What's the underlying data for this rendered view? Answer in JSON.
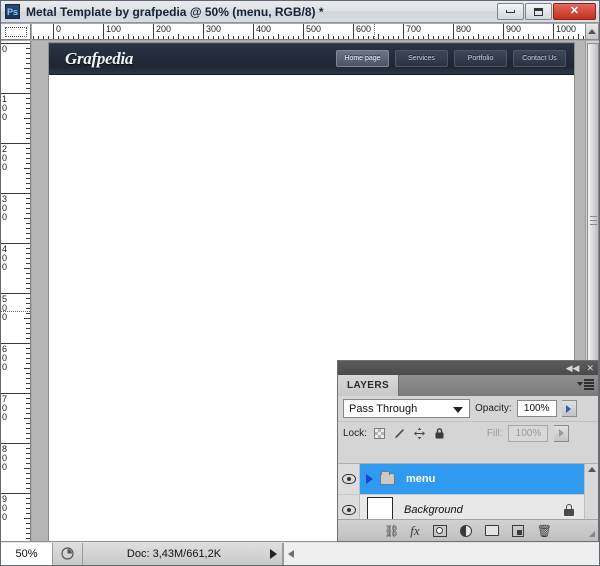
{
  "window": {
    "app_icon": "photoshop-logo-icon",
    "app_icon_text": "Ps",
    "title": "Metal Template by grafpedia @ 50% (menu, RGB/8) *",
    "controls": {
      "minimize": "minimize-icon",
      "maximize": "maximize-icon",
      "close": "✕"
    }
  },
  "rulers": {
    "unit_spacing_px": 50,
    "horizontal_labels": [
      "0",
      "100",
      "200",
      "300",
      "400",
      "500",
      "600",
      "700",
      "800",
      "900",
      "1000"
    ],
    "vertical_labels": [
      "0",
      "100",
      "200",
      "300",
      "400",
      "500",
      "600",
      "700",
      "800",
      "900"
    ],
    "horizontal_guide_at": "600",
    "vertical_guide_at": "500"
  },
  "canvas": {
    "site_header": {
      "logo": "Grafpedia",
      "nav": [
        {
          "label": "Home page",
          "active": true
        },
        {
          "label": "Services",
          "active": false
        },
        {
          "label": "Portfolio",
          "active": false
        },
        {
          "label": "Contact Us",
          "active": false
        }
      ]
    }
  },
  "statusbar": {
    "zoom": "50%",
    "status_icon": "document-thumb-icon",
    "doc_info": "Doc: 3,43M/661,2K",
    "expand_icon": "play-arrow-icon",
    "scroll_left_icon": "scroll-left-icon"
  },
  "layers_panel": {
    "collapse_icon": "collapse-panel-icon",
    "close_icon": "close-panel-icon",
    "tab_label": "LAYERS",
    "panel_menu_icon": "panel-menu-icon",
    "blend_mode": {
      "value": "Pass Through",
      "dropdown_icon": "chevron-down-icon"
    },
    "opacity": {
      "label": "Opacity:",
      "value": "100%",
      "stepper_icon": "stepper-arrow-icon"
    },
    "lock": {
      "label": "Lock:",
      "icons": [
        "lock-transparent-pixels-icon",
        "lock-image-pixels-icon",
        "lock-position-icon",
        "lock-all-icon"
      ]
    },
    "fill": {
      "label": "Fill:",
      "value": "100%",
      "disabled": true,
      "stepper_icon": "stepper-arrow-icon"
    },
    "layers": [
      {
        "name": "menu",
        "type": "group",
        "visible": true,
        "selected": true,
        "expanded": false,
        "visibility_icon": "eye-icon",
        "expand_icon": "expand-triangle-icon",
        "group_icon": "folder-icon",
        "locked": false
      },
      {
        "name": "Background",
        "type": "layer",
        "visible": true,
        "selected": false,
        "visibility_icon": "eye-icon",
        "thumbnail": "white-thumbnail",
        "locked": true,
        "lock_icon": "padlock-icon"
      }
    ],
    "footer_icons": [
      "link-layers-icon",
      "add-layer-style-icon",
      "add-layer-mask-icon",
      "new-adjustment-layer-icon",
      "new-group-icon",
      "new-layer-icon",
      "delete-layer-icon"
    ],
    "resize_grip": "resize-grip-icon"
  },
  "scrollbars": {
    "vertical_thumb_grip": "scroll-grip-icon",
    "ruler_scroll_up_icon": "scroll-up-icon"
  },
  "colors": {
    "selection_blue": "#2e9bf0",
    "site_header_navy": "#242d3d",
    "panel_gray": "#d5d5d5",
    "titlebar_light": "#dfe2e5",
    "close_red": "#c2301d"
  }
}
